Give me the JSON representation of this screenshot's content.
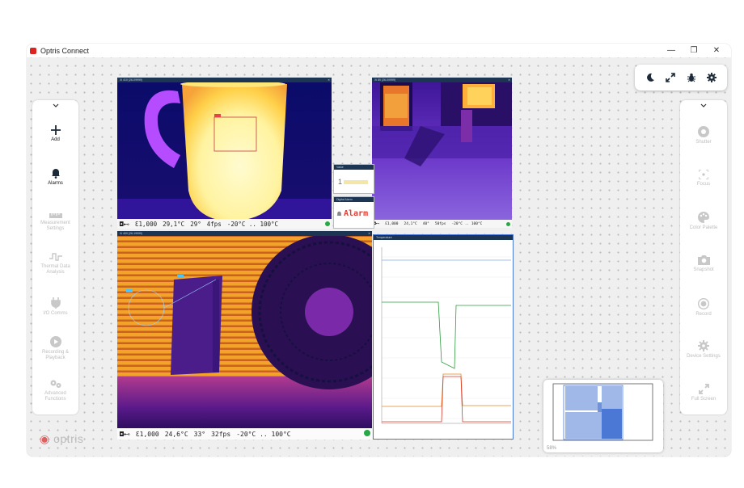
{
  "app": {
    "title": "Optris Connect"
  },
  "window_controls": {
    "minimize": "—",
    "restore": "❐",
    "close": "✕"
  },
  "toolbar_icons": [
    "moon-icon",
    "expand-icon",
    "bug-icon",
    "gear-icon"
  ],
  "left_panel": {
    "items": [
      {
        "label": "Add",
        "icon": "plus-icon",
        "enabled": true
      },
      {
        "label": "Alarms",
        "icon": "bell-icon",
        "enabled": true
      },
      {
        "label": "Measurement Settings",
        "icon": "ruler-icon",
        "enabled": false
      },
      {
        "label": "Thermal Data Analysis",
        "icon": "pulse-icon",
        "enabled": false
      },
      {
        "label": "I/O Comms",
        "icon": "plug-icon",
        "enabled": false
      },
      {
        "label": "Recording & Playback",
        "icon": "play-icon",
        "enabled": false
      },
      {
        "label": "Advanced Functions",
        "icon": "gears-icon",
        "enabled": false
      }
    ]
  },
  "right_panel": {
    "items": [
      {
        "label": "Shutter",
        "icon": "aperture-icon"
      },
      {
        "label": "Focus",
        "icon": "focus-icon"
      },
      {
        "label": "Color Palette",
        "icon": "palette-icon"
      },
      {
        "label": "Snapshot",
        "icon": "camera-icon"
      },
      {
        "label": "Record",
        "icon": "record-icon"
      },
      {
        "label": "Device Settings",
        "icon": "gear-icon"
      },
      {
        "label": "Full Screen",
        "icon": "fullscreen-icon"
      }
    ]
  },
  "views": {
    "mug": {
      "header": "Xi 410 (26-09999)",
      "status": {
        "emissivity": "Ɛ1,000",
        "temp": "29,1°C",
        "fov": "29°",
        "fps": "4fps",
        "range": "-20°C .. 100°C"
      }
    },
    "room": {
      "header": "Xi 80 (26-00999)",
      "status": {
        "emissivity": "Ɛ1,000",
        "temp": "24,1°C",
        "fov": "40°",
        "fps": "50fps",
        "range": "-20°C .. 100°C"
      }
    },
    "fan": {
      "header": "Xi 400 (26-19999)",
      "status": {
        "emissivity": "Ɛ1,000",
        "temp": "24,6°C",
        "fov": "33°",
        "fps": "32fps",
        "range": "-20°C .. 100°C"
      }
    },
    "value_widget": {
      "header": "Value",
      "value": "1"
    },
    "alarm_widget": {
      "header": "Digital Alarm",
      "label": "Alarm"
    },
    "chart_widget": {
      "header": "Temperature"
    }
  },
  "minimap": {
    "zoom": "58%"
  },
  "logo": "optris",
  "colors": {
    "header": "#1b3552",
    "status_ok": "#27a844",
    "alarm": "#e03c31"
  }
}
